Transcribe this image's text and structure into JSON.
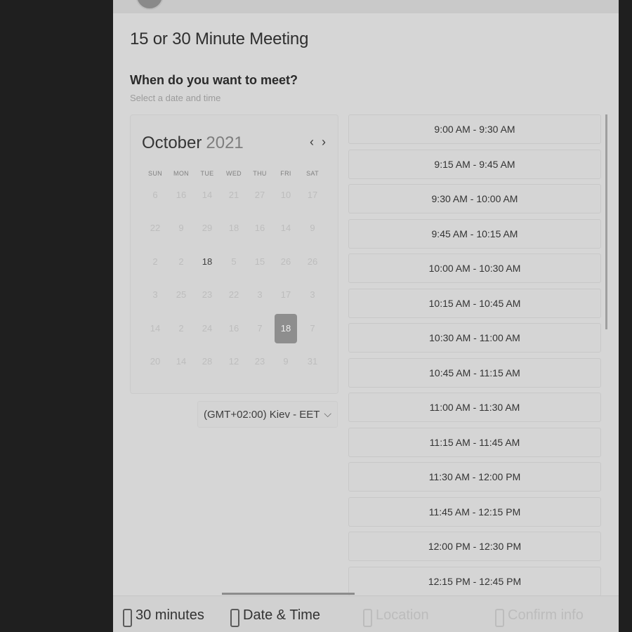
{
  "page": {
    "title": "15 or 30 Minute Meeting",
    "question": "When do you want to meet?",
    "subtitle": "Select a date and time"
  },
  "calendar": {
    "month": "October",
    "year": "2021",
    "prev_icon": "‹",
    "next_icon": "›",
    "weekdays": [
      "SUN",
      "MON",
      "TUE",
      "WED",
      "THU",
      "FRI",
      "SAT"
    ],
    "weeks": [
      [
        "6",
        "16",
        "14",
        "21",
        "27",
        "10",
        "17"
      ],
      [
        "22",
        "9",
        "29",
        "18",
        "16",
        "14",
        "9"
      ],
      [
        "2",
        "2",
        "18",
        "5",
        "15",
        "26",
        "26"
      ],
      [
        "3",
        "25",
        "23",
        "22",
        "3",
        "17",
        "3"
      ],
      [
        "14",
        "2",
        "24",
        "16",
        "7",
        "18",
        "7"
      ],
      [
        "20",
        "14",
        "28",
        "12",
        "23",
        "9",
        "31"
      ]
    ],
    "today": {
      "week": 2,
      "day": 2
    },
    "selected": {
      "week": 4,
      "day": 5
    }
  },
  "timezone": {
    "label": "(GMT+02:00) Kiev - EET",
    "chevron_icon": "chevron-down-icon"
  },
  "slots": [
    "9:00 AM - 9:30 AM",
    "9:15 AM - 9:45 AM",
    "9:30 AM - 10:00 AM",
    "9:45 AM - 10:15 AM",
    "10:00 AM - 10:30 AM",
    "10:15 AM - 10:45 AM",
    "10:30 AM - 11:00 AM",
    "10:45 AM - 11:15 AM",
    "11:00 AM - 11:30 AM",
    "11:15 AM - 11:45 AM",
    "11:30 AM - 12:00 PM",
    "11:45 AM - 12:15 PM",
    "12:00 PM - 12:30 PM",
    "12:15 PM - 12:45 PM"
  ],
  "steps": [
    {
      "label": "30 minutes",
      "icon": "clock-icon",
      "active": true
    },
    {
      "label": "Date & Time",
      "icon": "calendar-icon",
      "active": true
    },
    {
      "label": "Location",
      "icon": "location-icon",
      "active": false
    },
    {
      "label": "Confirm info",
      "icon": "info-icon",
      "active": false
    }
  ]
}
